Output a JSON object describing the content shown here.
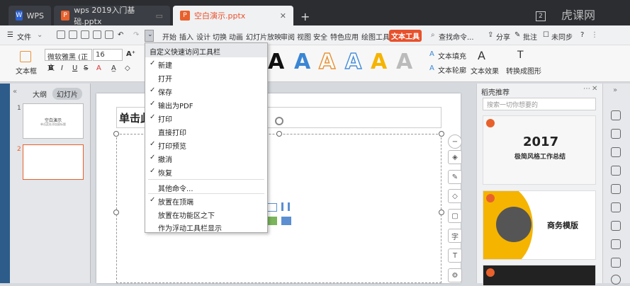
{
  "tabs": {
    "wps_label": "WPS",
    "doc1_label": "wps 2019入门基础.pptx",
    "doc2_label": "空白演示.pptx",
    "badge": "2",
    "watermark": "虎课网"
  },
  "menu": {
    "file": "文件",
    "items": [
      "开始",
      "插入",
      "设计",
      "切换",
      "动画",
      "幻灯片放映",
      "审阅",
      "视图",
      "安全",
      "特色应用",
      "绘图工具"
    ],
    "active_tab": "文本工具",
    "search": "查找命令...",
    "share": "分享",
    "comment": "批注",
    "sync": "未同步"
  },
  "ribbon": {
    "textbox_label": "文本框",
    "font_name": "微软雅黑 (正文",
    "font_size": "16",
    "text_fill": "文本填充",
    "text_outline": "文本轮廓",
    "text_effect": "文本效果",
    "convert_art": "转换成图形"
  },
  "left_panel": {
    "tab_outline": "大纲",
    "tab_slides": "幻灯片",
    "slide1_title": "空白演示",
    "slide1_sub": "单击此处添加副标题",
    "slide1_num": "1",
    "slide2_num": "2"
  },
  "slide": {
    "title_text": "单击此"
  },
  "right_panel": {
    "title": "稻壳推荐",
    "search_placeholder": "搜索一切你想要的",
    "card1_year": "2017",
    "card1_title": "极简风格工作总结",
    "card2_title": "商务模版"
  },
  "dropdown": {
    "header": "自定义快速访问工具栏",
    "items": [
      {
        "label": "新建",
        "checked": "✓"
      },
      {
        "label": "打开",
        "checked": ""
      },
      {
        "label": "保存",
        "checked": "✓"
      },
      {
        "label": "输出为PDF",
        "checked": "✓"
      },
      {
        "label": "打印",
        "checked": "✓"
      },
      {
        "label": "直接打印",
        "checked": ""
      },
      {
        "label": "打印预览",
        "checked": "✓"
      },
      {
        "label": "撤消",
        "checked": "✓"
      },
      {
        "label": "恢复",
        "checked": "✓"
      },
      {
        "label": "其他命令...",
        "checked": ""
      },
      {
        "label": "放置在顶端",
        "checked": "✓"
      },
      {
        "label": "放置在功能区之下",
        "checked": ""
      },
      {
        "label": "作为浮动工具栏显示",
        "checked": ""
      }
    ]
  },
  "colors": {
    "accent": "#e8512c",
    "art_black": "#111111",
    "art_blue": "#3a86d4",
    "art_orange_outline": "#e8943a",
    "art_blue_outline": "#4a90d9",
    "art_yellow": "#f5b400",
    "art_gray": "#999999"
  }
}
